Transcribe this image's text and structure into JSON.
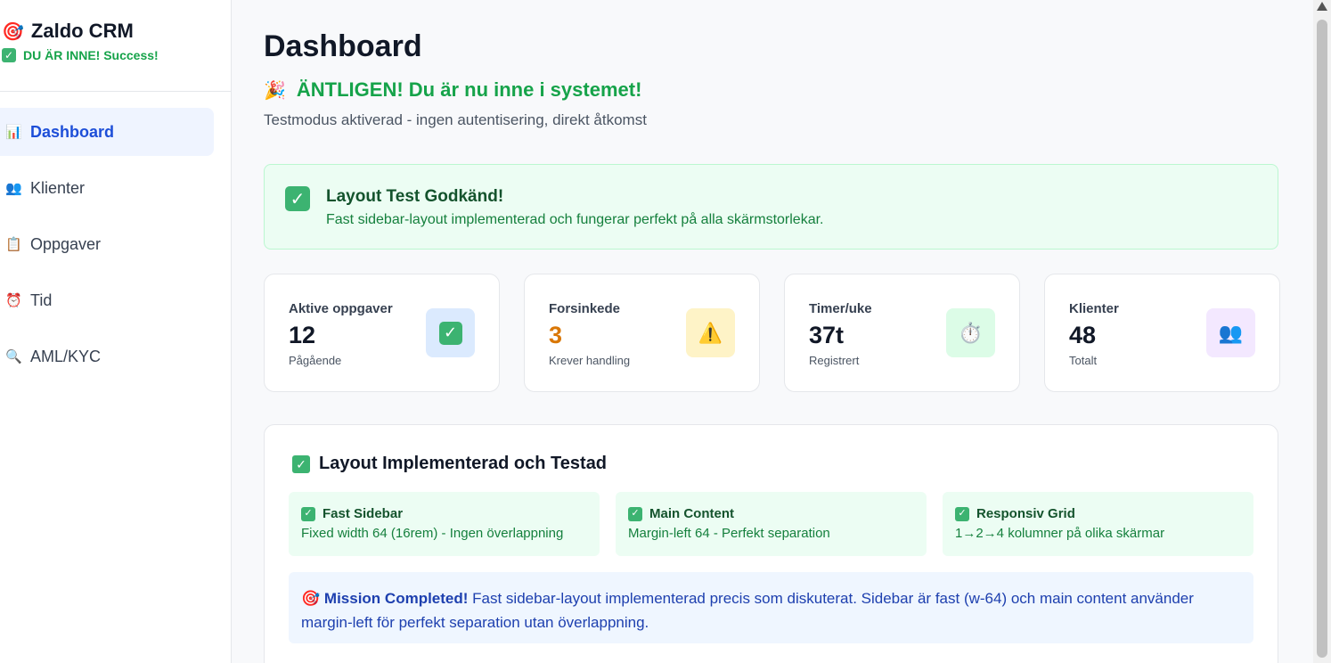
{
  "sidebar": {
    "brand": {
      "icon": "🎯",
      "title": "Zaldo CRM",
      "status_icon": "✓",
      "status": "DU ÄR INNE! Success!"
    },
    "items": [
      {
        "icon": "📊",
        "label": "Dashboard",
        "active": true
      },
      {
        "icon": "👥",
        "label": "Klienter"
      },
      {
        "icon": "📋",
        "label": "Oppgaver"
      },
      {
        "icon": "⏰",
        "label": "Tid"
      },
      {
        "icon": "🔍",
        "label": "AML/KYC"
      }
    ]
  },
  "main": {
    "title": "Dashboard",
    "celebrate_icon": "🎉",
    "celebrate": "ÄNTLIGEN! Du är nu inne i systemet!",
    "subtitle": "Testmodus aktiverad - ingen autentisering, direkt åtkomst",
    "banner": {
      "title": "Layout Test Godkänd!",
      "desc": "Fast sidebar-layout implementerad och fungerar perfekt på alla skärmstorlekar."
    },
    "stats": [
      {
        "label": "Aktive oppgaver",
        "value": "12",
        "sub": "Pågående",
        "icon": "✓"
      },
      {
        "label": "Forsinkede",
        "value": "3",
        "sub": "Krever handling",
        "icon": "⚠️"
      },
      {
        "label": "Timer/uke",
        "value": "37t",
        "sub": "Registrert",
        "icon": "⏱️"
      },
      {
        "label": "Klienter",
        "value": "48",
        "sub": "Totalt",
        "icon": "👥"
      }
    ],
    "impl": {
      "title": "Layout Implementerad och Testad",
      "features": [
        {
          "title": "Fast Sidebar",
          "desc": "Fixed width 64 (16rem) - Ingen överlappning"
        },
        {
          "title": "Main Content",
          "desc": "Margin-left 64 - Perfekt separation"
        },
        {
          "title": "Responsiv Grid",
          "desc": "1→2→4 kolumner på olika skärmar"
        }
      ],
      "mission_icon": "🎯",
      "mission_label": "Mission Completed!",
      "mission_text": " Fast sidebar-layout implementerad precis som diskuterat. Sidebar är fast (w-64) och main content använder margin-left för perfekt separation utan överlappning."
    }
  },
  "colors": {
    "accent": "#1d4ed8",
    "success": "#16a34a",
    "warning": "#d97706"
  }
}
